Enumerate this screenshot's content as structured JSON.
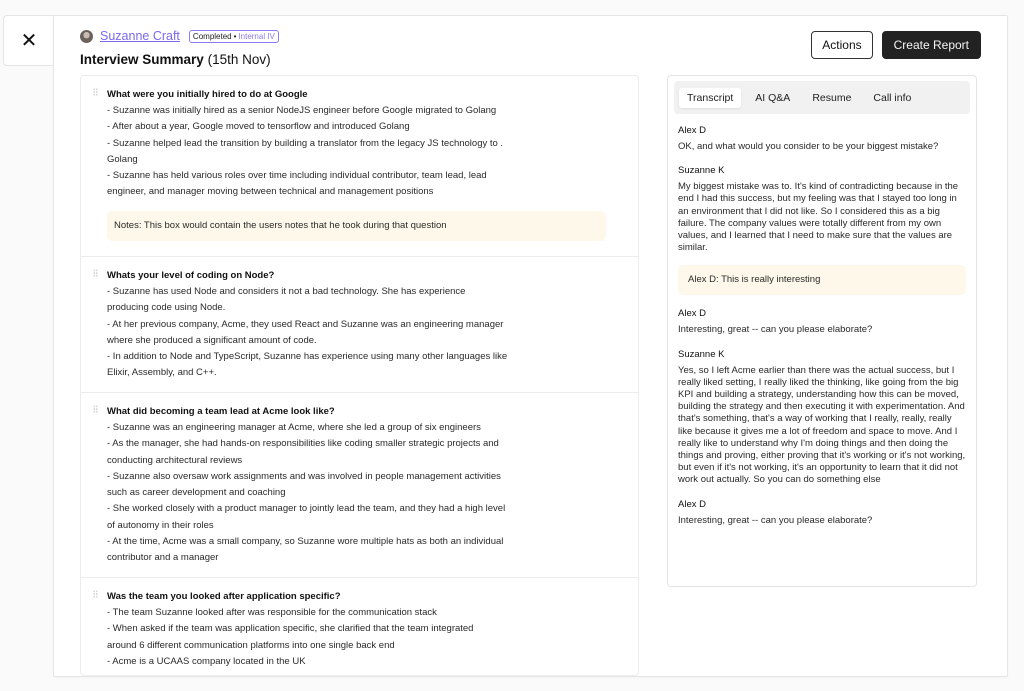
{
  "close": {
    "icon": "close-icon",
    "glyph": "✕"
  },
  "candidate": {
    "name": "Suzanne Craft",
    "status": "Completed",
    "separator": "•",
    "interview_type": "Internal IV"
  },
  "title": {
    "bold": "Interview Summary",
    "date": "(15th Nov)"
  },
  "actions": {
    "actions_label": "Actions",
    "create_report_label": "Create Report"
  },
  "colors": {
    "accent": "#7b68ee",
    "dark_button": "#222222",
    "note_bg": "#fdf8ea"
  },
  "summary": {
    "questions": [
      {
        "title": "What were you initially hired to do at Google",
        "lines": [
          "- Suzanne was initially hired as a senior NodeJS engineer before Google migrated to Golang",
          "- After about a year, Google moved to tensorflow and introduced Golang",
          "- Suzanne helped lead the transition by building a translator from the legacy JS technology to  .",
          "Golang",
          "- Suzanne has held various roles over time including individual contributor, team lead, lead",
          "engineer, and manager moving between technical and management positions"
        ],
        "note": "Notes: This box would contain the users notes that he took during that question"
      },
      {
        "title": "Whats your level of coding on Node?",
        "lines": [
          "- Suzanne has used Node and considers it not a bad technology. She has experience",
          "producing code using Node.",
          "- At her previous company, Acme, they used React and Suzanne was an engineering manager",
          "where she produced a significant amount of code.",
          "- In addition to Node and TypeScript, Suzanne has experience using many other languages like",
          "Elixir, Assembly, and C++."
        ]
      },
      {
        "title": "What did becoming a team lead at Acme look like?",
        "lines": [
          "- Suzanne was an engineering manager at Acme, where she led a group of six engineers",
          "- As the manager, she had hands-on responsibilities like coding smaller strategic projects and",
          "conducting architectural reviews",
          "- Suzanne also oversaw work assignments and was involved in people management activities",
          "such as career development and coaching",
          "- She worked closely with a product manager to jointly lead the team, and they had a high level",
          "of autonomy in their roles",
          "- At the time, Acme was a small company, so Suzanne wore multiple hats as both an individual",
          "contributor and a manager"
        ]
      },
      {
        "title": "Was the team you looked after application specific?",
        "lines": [
          "- The team Suzanne looked after was responsible for the communication stack",
          "- When asked if the team was application specific, she clarified that the team integrated",
          "around 6 different communication platforms into one single back end",
          "- Acme is a UCAAS company located in the UK"
        ]
      }
    ]
  },
  "transcript": {
    "tabs": [
      {
        "label": "Transcript",
        "active": true
      },
      {
        "label": "AI Q&A",
        "active": false
      },
      {
        "label": "Resume",
        "active": false
      },
      {
        "label": "Call info",
        "active": false
      }
    ],
    "entries": [
      {
        "speaker": "Alex D",
        "text": "OK, and what would you consider to be your biggest mistake?"
      },
      {
        "speaker": "Suzanne K",
        "text": "My biggest mistake was to. It's kind of contradicting because in the end I had this success, but my feeling was that I stayed too long in an environment that I did not like. So I considered this as a big failure. The company values were totally different from my own values, and I learned that I need to make sure that the values are similar."
      },
      {
        "note": "Alex D: This is really interesting"
      },
      {
        "speaker": "Alex D",
        "text": "Interesting, great -- can you please elaborate?"
      },
      {
        "speaker": "Suzanne K",
        "text": "Yes, so I left Acme earlier than there was the actual success, but I really liked setting, I really liked the thinking, like going from the big KPI and building a strategy, understanding how this can be moved, building the strategy and then executing it with experimentation. And that's something, that's a way of working that I really, really, really like because it gives me a lot of freedom and space to move. And I really like to understand why I'm doing things and then doing the things and proving, either proving that it's working or it's not working, but even if it's not working, it's an opportunity to learn that it did not work out actually. So you can do something else"
      },
      {
        "speaker": "Alex D",
        "text": "Interesting, great -- can you please elaborate?"
      }
    ]
  }
}
